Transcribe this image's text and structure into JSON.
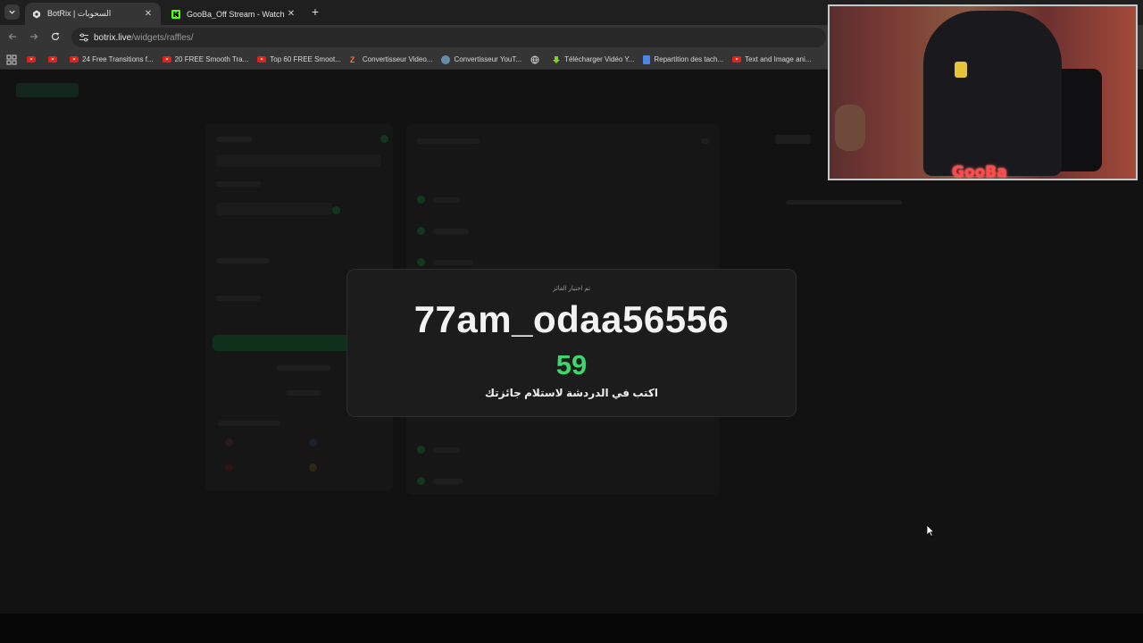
{
  "tabs": [
    {
      "title": "BotRix | السحوبات",
      "active": true
    },
    {
      "title": "GooBa_Off Stream - Watch Live",
      "active": false
    }
  ],
  "toolbar": {
    "url_host": "botrix.live",
    "url_path": "/widgets/raffles/"
  },
  "bookmarks": [
    {
      "icon": "youtube-icon",
      "label": ""
    },
    {
      "icon": "youtube-icon",
      "label": ""
    },
    {
      "icon": "youtube-icon",
      "label": "24 Free Transitions f..."
    },
    {
      "icon": "youtube-icon",
      "label": "20 FREE Smooth Tra..."
    },
    {
      "icon": "youtube-icon",
      "label": "Top 60 FREE Smoot..."
    },
    {
      "icon": "z-icon",
      "label": "Convertisseur Video..."
    },
    {
      "icon": "converter-icon",
      "label": "Convertisseur YouT..."
    },
    {
      "icon": "globe-icon",
      "label": ""
    },
    {
      "icon": "download-icon",
      "label": "Télécharger Vidéo Y..."
    },
    {
      "icon": "document-icon",
      "label": "Repartition des tach..."
    },
    {
      "icon": "youtube-icon",
      "label": "Text and Image ani..."
    }
  ],
  "modal": {
    "caption": "تم اختيار الفائز",
    "winner": "77am_odaa56556",
    "count": "59",
    "instruction": "اكتب في الدردشة لاستلام جائزتك"
  },
  "webcam": {
    "logo": "GooBa"
  },
  "colors": {
    "accent_green": "#3dd66d",
    "page_bg": "#121212",
    "modal_bg": "#1c1c1c"
  }
}
